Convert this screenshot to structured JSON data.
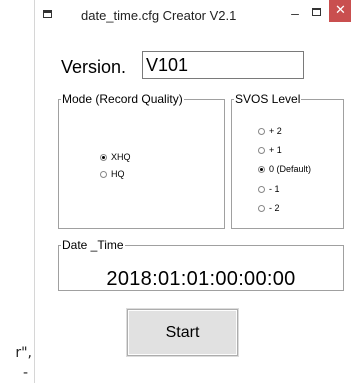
{
  "background_snippet": {
    "line1": "r\",",
    "line2": "-"
  },
  "window": {
    "title": "date_time.cfg Creator V2.1",
    "app_icon": "window-app-icon",
    "controls": {
      "minimize": "–",
      "maximize_icon": "maximize-icon",
      "close": "✕"
    }
  },
  "version": {
    "label": "Version.",
    "value": "V101"
  },
  "mode_group": {
    "legend": "Mode (Record Quality)",
    "options": [
      {
        "label": "XHQ",
        "checked": true
      },
      {
        "label": "HQ",
        "checked": false
      }
    ]
  },
  "svos_group": {
    "legend": "SVOS Level",
    "options": [
      {
        "label": "+ 2",
        "checked": false
      },
      {
        "label": "+ 1",
        "checked": false
      },
      {
        "label": "0 (Default)",
        "checked": true
      },
      {
        "label": "- 1",
        "checked": false
      },
      {
        "label": "- 2",
        "checked": false
      }
    ]
  },
  "datetime_group": {
    "legend": "Date _Time",
    "value": "2018:01:01:00:00:00"
  },
  "start_button": {
    "label": "Start"
  },
  "colors": {
    "close_button": "#c94f4f",
    "group_border": "#a0a0a0",
    "button_face": "#e1e1e1"
  }
}
